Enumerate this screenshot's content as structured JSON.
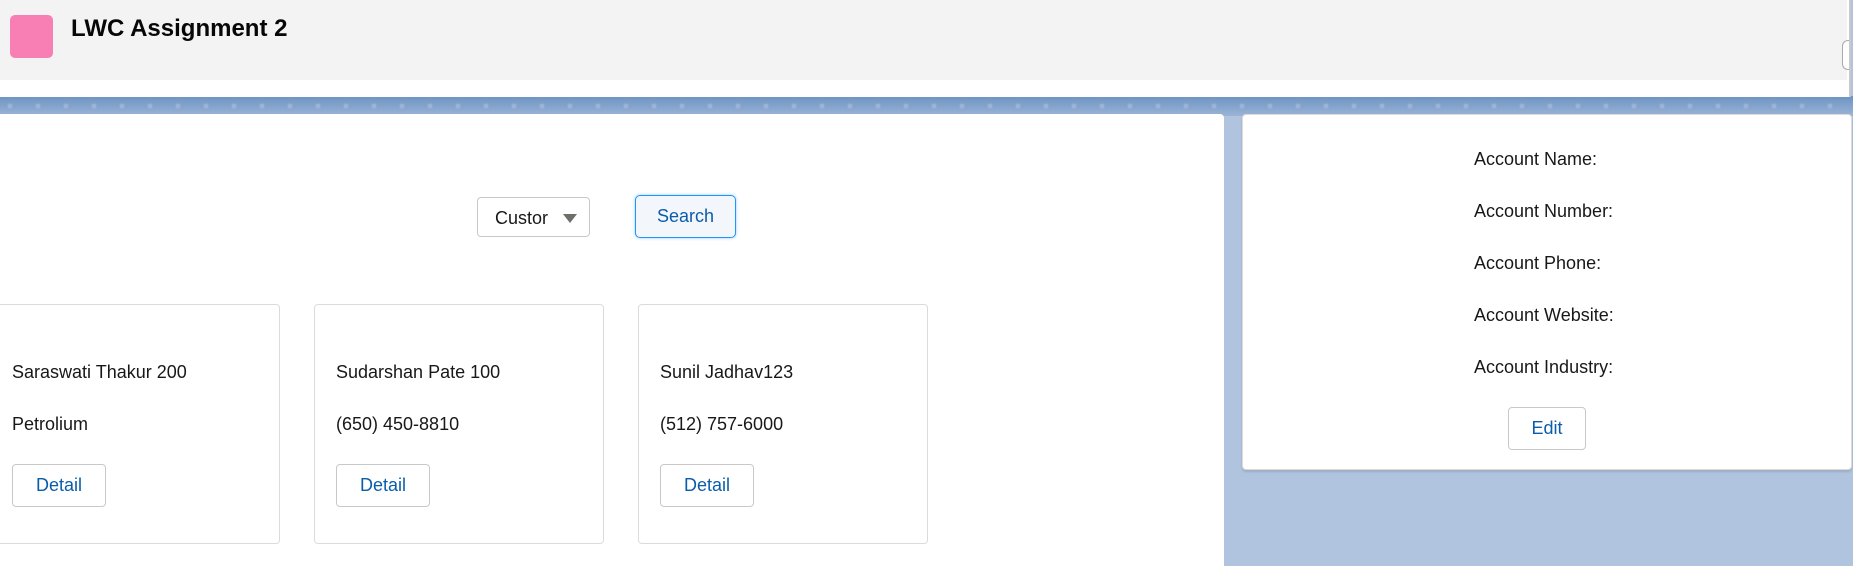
{
  "app": {
    "title": "LWC Assignment 2",
    "icon": "app-tile-icon",
    "icon_color": "#f77fb4"
  },
  "filter": {
    "selected": "Custor",
    "search_label": "Search"
  },
  "cards": [
    {
      "name": "Saraswati Thakur 200",
      "sub": "Petrolium",
      "button": "Detail"
    },
    {
      "name": "Sudarshan Pate 100",
      "sub": "(650) 450-8810",
      "button": "Detail"
    },
    {
      "name": "Sunil Jadhav123",
      "sub": "(512) 757-6000",
      "button": "Detail"
    }
  ],
  "details": {
    "labels": [
      "Account Name:",
      "Account Number:",
      "Account Phone:",
      "Account Website:",
      "Account Industry:"
    ],
    "edit_label": "Edit"
  },
  "colors": {
    "accent": "#0b5cab",
    "background": "#b0c4df"
  }
}
